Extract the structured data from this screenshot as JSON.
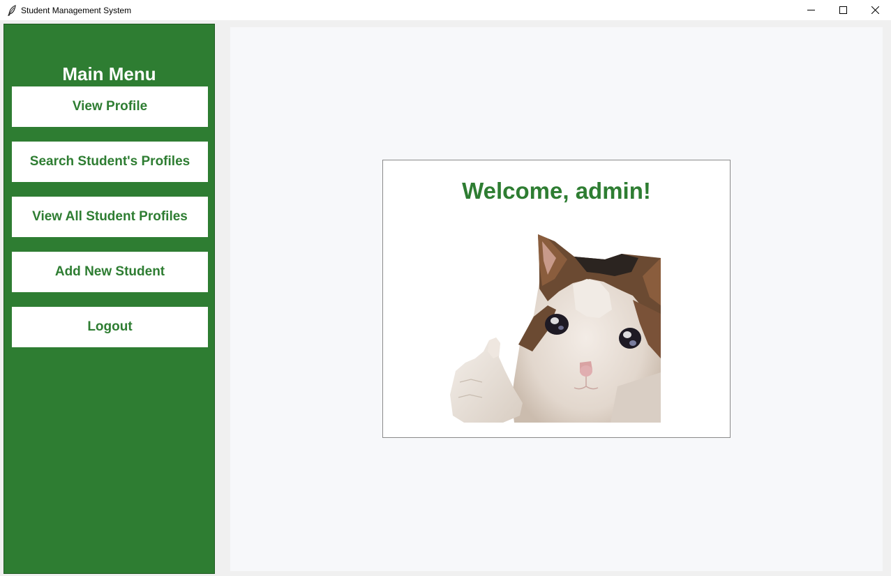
{
  "window": {
    "title": "Student Management System",
    "icon": "feather-icon",
    "controls": [
      "minimize-icon",
      "maximize-icon",
      "close-icon"
    ]
  },
  "sidebar": {
    "title": "Main Menu",
    "items": [
      {
        "label": "View Profile"
      },
      {
        "label": "Search Student's Profiles"
      },
      {
        "label": "View All Student Profiles"
      },
      {
        "label": "Add New Student"
      },
      {
        "label": "Logout"
      }
    ]
  },
  "main": {
    "welcome": "Welcome, admin!",
    "image": "crying-cat-thumbs-up"
  },
  "colors": {
    "accent": "#2e7d32",
    "sidebar_bg": "#2e7d32",
    "button_bg": "#ffffff",
    "main_bg": "#f7f8fa"
  }
}
